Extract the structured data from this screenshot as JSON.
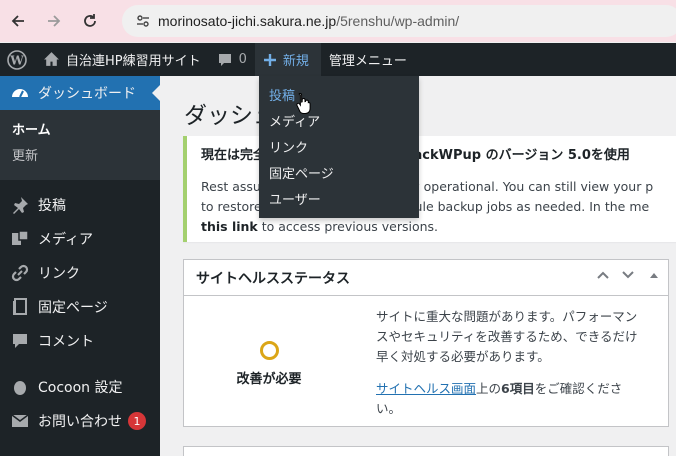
{
  "browser": {
    "url_host": "morinosato-jichi.sakura.ne.jp",
    "url_path": "/5renshu/wp-admin/"
  },
  "adminbar": {
    "site_name": "自治連HP練習用サイト",
    "comments_count": "0",
    "new_label": "新規",
    "admin_menu_label": "管理メニュー"
  },
  "new_menu": {
    "items": [
      "投稿",
      "メディア",
      "リンク",
      "固定ページ",
      "ユーザー"
    ]
  },
  "sidebar": {
    "dashboard_label": "ダッシュボード",
    "submenu": [
      "ホーム",
      "更新"
    ],
    "items": [
      {
        "label": "投稿",
        "icon": "pin-icon"
      },
      {
        "label": "メディア",
        "icon": "media-icon"
      },
      {
        "label": "リンク",
        "icon": "link-icon"
      },
      {
        "label": "固定ページ",
        "icon": "page-icon"
      },
      {
        "label": "コメント",
        "icon": "comment-icon"
      }
    ],
    "cocoon_label": "Cocoon 設定",
    "contact_label": "お問い合わせ",
    "contact_badge": "1"
  },
  "main": {
    "title": "ダッシュ"
  },
  "notice": {
    "title": "現在は完全",
    "title_tail": "ェイスのBackWPup のバージョン 5.0を使用",
    "line1_a": "Rest assur",
    "line1_b": "ain fully operational. You can still view your p",
    "line2_a": "to restore",
    "line2_b": "d schedule backup jobs as needed. In the me",
    "link": "this link",
    "line3_tail": " to access previous versions."
  },
  "site_health": {
    "title": "サイトヘルスステータス",
    "status": "改善が必要",
    "desc1": "サイトに重大な問題があります。パフォーマン",
    "desc2": "スやセキュリティを改善するため、できるだけ",
    "desc3": "早く対処する必要があります。",
    "link_text": "サイトヘルス画面",
    "desc4_a": "上の",
    "count": "6項目",
    "desc4_b": "をご確認くださ",
    "desc5": "い。"
  },
  "colors": {
    "wp_dark": "#1d2327",
    "wp_blue": "#2271b1",
    "wp_link_hover": "#72aee6",
    "warning": "#dba617",
    "badge": "#d63638"
  }
}
